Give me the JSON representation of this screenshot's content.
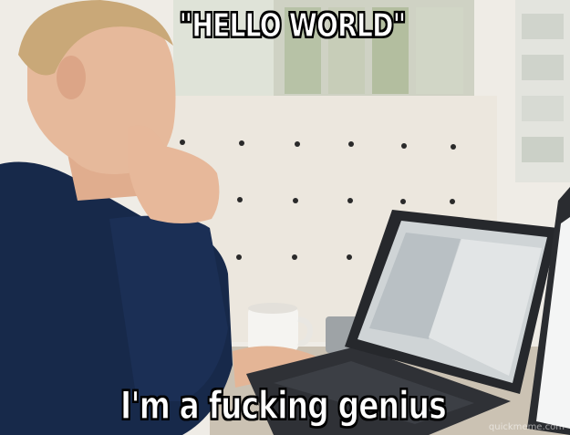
{
  "meme": {
    "top_text": "\"HELLO WORLD\"",
    "bottom_text": "I'm a fucking genius",
    "watermark": "quickmeme.com"
  },
  "scene": {
    "subject": "person in navy sweater thinking with hand on chin",
    "objects": [
      "laptop",
      "coffee mug",
      "pegboard partition",
      "office window"
    ]
  },
  "colors": {
    "sweater": "#17294a",
    "skin": "#e6b99b",
    "hair": "#c9a878",
    "pegboard": "#ece7de",
    "laptop_body": "#2f3136",
    "screen": "#cfd4d6",
    "caption_fill": "#ffffff",
    "caption_stroke": "#000000"
  }
}
